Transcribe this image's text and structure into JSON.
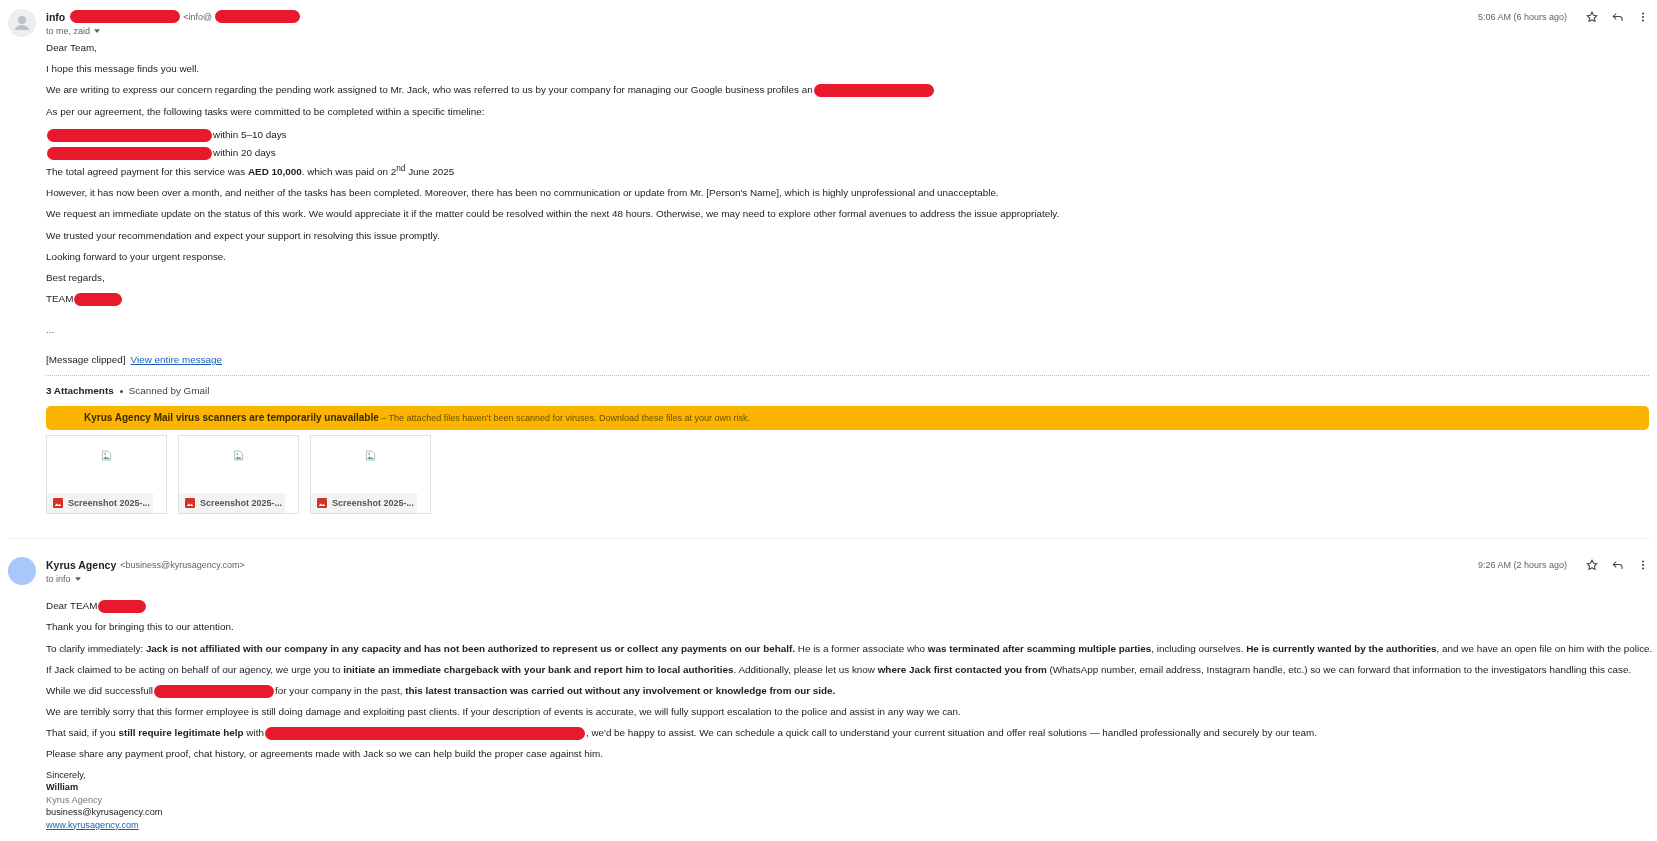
{
  "messages": [
    {
      "avatar": {
        "kind": "person"
      },
      "sender": {
        "name": "info",
        "name_redaction": true,
        "email": "<info@",
        "email_redaction": true
      },
      "recipients": "to me, zaid",
      "time": "5:06 AM (6 hours ago)",
      "body": [
        {
          "kind": "para",
          "segments": [
            {
              "kind": "text",
              "text": "Dear Team,"
            }
          ]
        },
        {
          "kind": "para",
          "segments": [
            {
              "kind": "text",
              "text": "I hope this message finds you well."
            }
          ]
        },
        {
          "kind": "para",
          "segments": [
            {
              "kind": "text",
              "text": "We are writing to express our concern regarding the pending work assigned to Mr. Jack, who was referred to us by your company for managing our Google business profiles an"
            },
            {
              "kind": "medium-redaction"
            }
          ]
        },
        {
          "kind": "para",
          "segments": [
            {
              "kind": "text",
              "text": "As per our agreement, the following tasks were committed to be completed within a specific timeline:"
            }
          ]
        },
        {
          "kind": "line",
          "segments": [
            {
              "kind": "long-redaction"
            },
            {
              "kind": "text",
              "text": "within 5–10 days"
            }
          ]
        },
        {
          "kind": "line",
          "segments": [
            {
              "kind": "long-redaction"
            },
            {
              "kind": "text",
              "text": "within 20 days"
            }
          ]
        },
        {
          "kind": "para",
          "segments": [
            {
              "kind": "text",
              "text": "The total agreed payment for this service was **AED 10,000**. which was paid on 2$^{nd}$ June 2025"
            }
          ]
        },
        {
          "kind": "para",
          "segments": [
            {
              "kind": "text",
              "text": "However, it has now been over a month, and neither of the tasks has been completed. Moreover, there has been no communication or update from Mr. [Person's Name], which is highly unprofessional and unacceptable."
            }
          ]
        },
        {
          "kind": "para",
          "segments": [
            {
              "kind": "text",
              "text": "We request an immediate update on the status of this work. We would appreciate it if the matter could be resolved within the next 48 hours. Otherwise, we may need to explore other formal avenues to address the issue appropriately."
            }
          ]
        },
        {
          "kind": "para",
          "segments": [
            {
              "kind": "text",
              "text": "We trusted your recommendation and expect your support in resolving this issue promptly."
            }
          ]
        },
        {
          "kind": "para",
          "segments": [
            {
              "kind": "text",
              "text": "Looking forward to your urgent response."
            }
          ]
        },
        {
          "kind": "para",
          "segments": [
            {
              "kind": "text",
              "text": "Best regards,"
            }
          ]
        },
        {
          "kind": "para",
          "segments": [
            {
              "kind": "text",
              "text": "TEAM"
            },
            {
              "kind": "short-redaction"
            }
          ]
        }
      ],
      "ellipsis": "...",
      "clipped": {
        "note": "[Message clipped]",
        "link": "View entire message"
      },
      "attachments": {
        "count_label": "3 Attachments",
        "scan_note": "Scanned by Gmail",
        "warning": "**Kyrus Agency Mail virus scanners are temporarily unavailable** – The attached files haven't been scanned for viruses. Download these files at your own risk.",
        "files": [
          {
            "name": "Screenshot 2025-..."
          },
          {
            "name": "Screenshot 2025-..."
          },
          {
            "name": "Screenshot 2025-..."
          }
        ]
      }
    },
    {
      "avatar": {
        "kind": "plain"
      },
      "sender": {
        "name": "Kyrus Agency",
        "email": "<business@kyrusagency.com>"
      },
      "recipients": "to info",
      "time": "9:26 AM (2 hours ago)",
      "body": [
        {
          "kind": "para",
          "segments": [
            {
              "kind": "text",
              "text": "Dear TEAM"
            },
            {
              "kind": "short-redaction"
            }
          ]
        },
        {
          "kind": "para",
          "segments": [
            {
              "kind": "text",
              "text": "Thank you for bringing this to our attention."
            }
          ]
        },
        {
          "kind": "para",
          "segments": [
            {
              "kind": "text",
              "text": "To clarify immediately: **Jack is not affiliated with our company in any capacity and has not been authorized to represent us or collect any payments on our behalf.** He is a former associate who **was terminated after scamming multiple parties**, including ourselves. **He is currently wanted by the authorities**, and we have an open file on him with the police."
            }
          ]
        },
        {
          "kind": "para",
          "segments": [
            {
              "kind": "text",
              "text": "If Jack claimed to be acting on behalf of our agency, we urge you to **initiate an immediate chargeback with your bank and report him to local authorities**. Additionally, please let us know **where Jack first contacted you from** (WhatsApp number, email address, Instagram handle, etc.) so we can forward that information to the investigators handling this case."
            }
          ]
        },
        {
          "kind": "para",
          "segments": [
            {
              "kind": "text",
              "text": "While we did successfull"
            },
            {
              "kind": "medium-redaction"
            },
            {
              "kind": "text",
              "text": "for your company in the past, **this latest transaction was carried out without any involvement or knowledge from our side.**"
            }
          ]
        },
        {
          "kind": "para",
          "segments": [
            {
              "kind": "text",
              "text": "We are terribly sorry that this former employee is still doing damage and exploiting past clients. If your description of events is accurate, we will fully support escalation to the police and assist in any way we can."
            }
          ]
        },
        {
          "kind": "para",
          "segments": [
            {
              "kind": "text",
              "text": "That said, if you **still require legitimate help** with"
            },
            {
              "kind": "extra-long-redaction"
            },
            {
              "kind": "text",
              "text": ", we'd be happy to assist. We can schedule a quick call to understand your current situation and offer real solutions — handled professionally and securely by our team."
            }
          ]
        },
        {
          "kind": "para",
          "segments": [
            {
              "kind": "text",
              "text": "Please share any payment proof, chat history, or agreements made with Jack so we can help build the proper case against him."
            }
          ]
        }
      ],
      "signature": [
        {
          "kind": "plain",
          "text": "Sincerely,"
        },
        {
          "kind": "bold",
          "text": "William"
        },
        {
          "kind": "muted",
          "text": "Kyrus Agency"
        },
        {
          "kind": "plain",
          "text": "business@kyrusagency.com"
        },
        {
          "kind": "link",
          "text": "www.kyrusagency.com"
        }
      ]
    }
  ]
}
